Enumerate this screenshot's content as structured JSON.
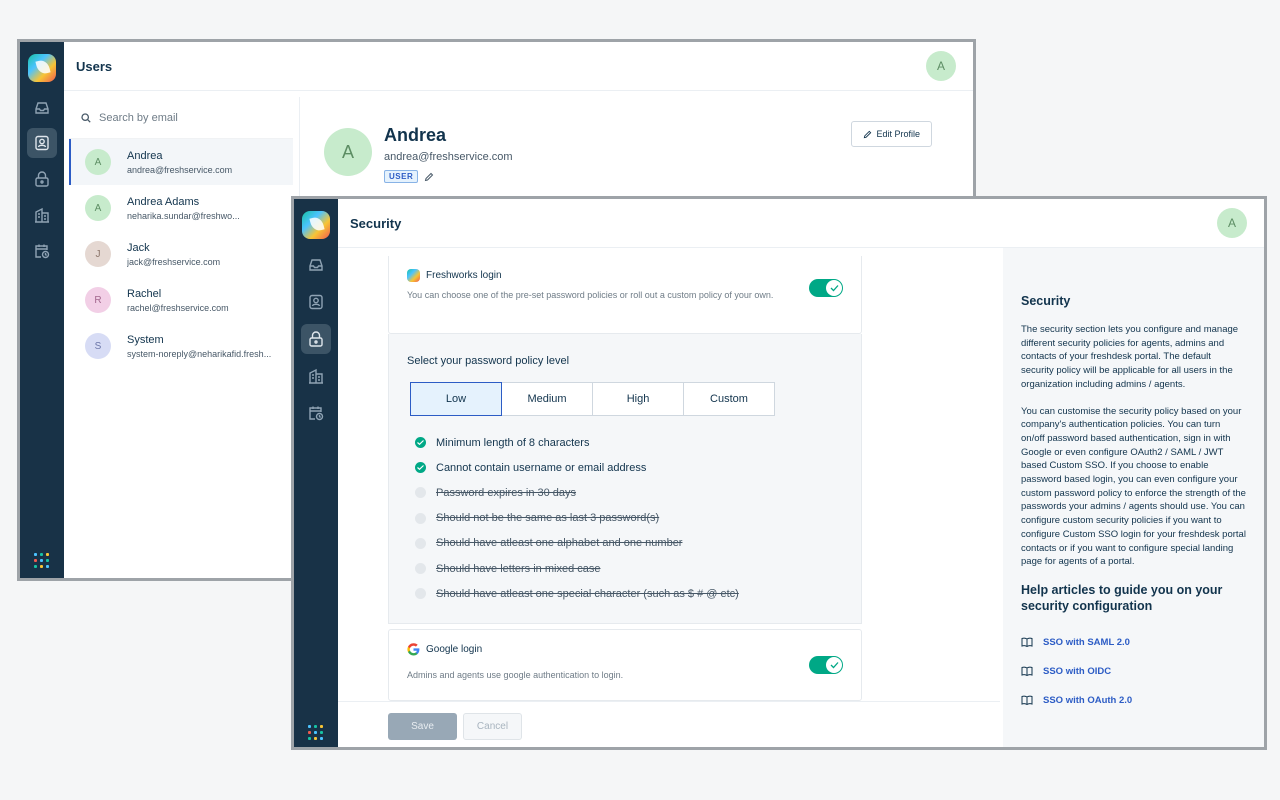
{
  "colors": {
    "rail": "#183247",
    "accent": "#2c5cc5",
    "toggle_on": "#00a886",
    "avatar_green": "#c7ebcc"
  },
  "users_window": {
    "title": "Users",
    "header_avatar": "A",
    "search": {
      "placeholder": "Search by email"
    },
    "users": [
      {
        "initial": "A",
        "name": "Andrea",
        "email": "andrea@freshservice.com",
        "avatar_color": "#c7ebcc",
        "initial_color": "#5c8d63"
      },
      {
        "initial": "A",
        "name": "Andrea Adams",
        "email": "neharika.sundar@freshwo...",
        "avatar_color": "#c7ebcc",
        "initial_color": "#5c8d63"
      },
      {
        "initial": "J",
        "name": "Jack",
        "email": "jack@freshservice.com",
        "avatar_color": "#e5d8d2",
        "initial_color": "#8b7469"
      },
      {
        "initial": "R",
        "name": "Rachel",
        "email": "rachel@freshservice.com",
        "avatar_color": "#f2cfe6",
        "initial_color": "#a3678e"
      },
      {
        "initial": "S",
        "name": "System",
        "email": "system-noreply@neharikafid.fresh...",
        "avatar_color": "#d7dcf5",
        "initial_color": "#6c76a9"
      }
    ],
    "profile": {
      "initial": "A",
      "name": "Andrea",
      "email": "andrea@freshservice.com",
      "badge": "USER",
      "edit_label": "Edit Profile"
    }
  },
  "security_window": {
    "title": "Security",
    "header_avatar": "A",
    "freshworks_login": {
      "title": "Freshworks login",
      "description": "You can choose one of the pre-set password policies or roll out a custom policy of your own.",
      "enabled": true
    },
    "policy": {
      "heading": "Select your password policy level",
      "levels": [
        "Low",
        "Medium",
        "High",
        "Custom"
      ],
      "selected": "Low",
      "rules": [
        {
          "text": "Minimum length of 8 characters",
          "enabled": true
        },
        {
          "text": "Cannot contain username or email address",
          "enabled": true
        },
        {
          "text": "Password expires in 30 days",
          "enabled": false
        },
        {
          "text": "Should not be the same as last 3 password(s)",
          "enabled": false
        },
        {
          "text": "Should have atleast one alphabet and one number",
          "enabled": false
        },
        {
          "text": "Should have letters in mixed case",
          "enabled": false
        },
        {
          "text": "Should have atleast one special character (such as $ # @ etc)",
          "enabled": false
        }
      ]
    },
    "google_login": {
      "title": "Google login",
      "description": "Admins and agents use google authentication to login.",
      "enabled": true
    },
    "footer": {
      "save_label": "Save",
      "cancel_label": "Cancel"
    },
    "help": {
      "title": "Security",
      "paragraph_1": "The security section lets you configure and manage different security policies for agents, admins and contacts of your freshdesk portal. The default security policy will be applicable for all users in the organization including admins / agents.",
      "paragraph_2": "You can customise the security policy based on your company's authentication policies. You can turn on/off password based authentication, sign in with Google or even configure OAuth2 / SAML / JWT based Custom SSO. If you choose to enable password based login, you can even configure your custom password policy to enforce the strength of the passwords your admins / agents should use. You can configure custom security policies if you want to configure Custom SSO login for your freshdesk portal contacts or if you want to configure special landing page for agents of a portal.",
      "articles_heading": "Help articles to guide you on your security configuration",
      "articles": [
        "SSO with SAML 2.0",
        "SSO with OIDC",
        "SSO with OAuth 2.0"
      ]
    }
  }
}
